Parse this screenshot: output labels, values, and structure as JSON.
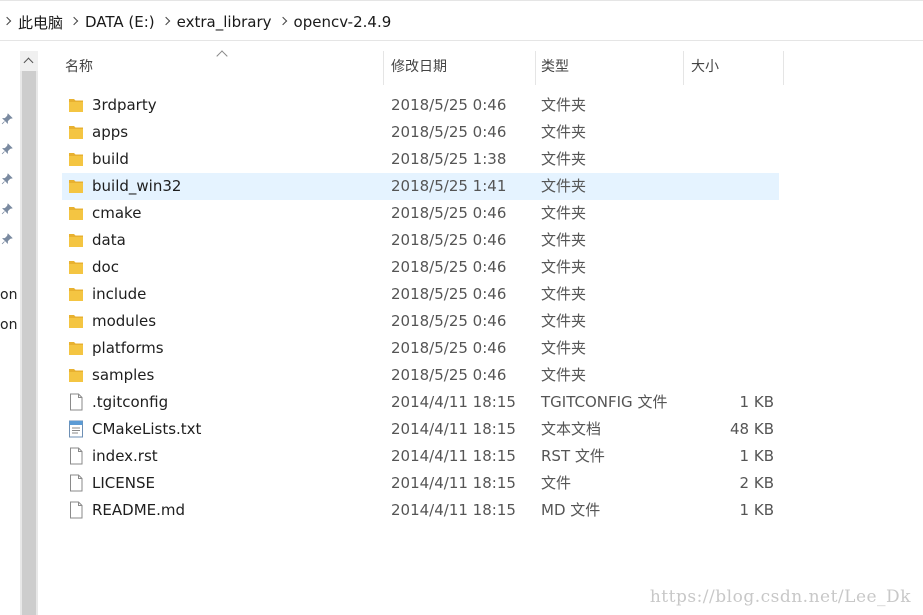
{
  "breadcrumbs": [
    "此电脑",
    "DATA (E:)",
    "extra_library",
    "opencv-2.4.9"
  ],
  "nav_pane_text": [
    "on",
    "on"
  ],
  "columns": {
    "name": "名称",
    "date": "修改日期",
    "type": "类型",
    "size": "大小"
  },
  "files": [
    {
      "name": "3rdparty",
      "date": "2018/5/25 0:46",
      "type": "文件夹",
      "size": "",
      "icon": "folder"
    },
    {
      "name": "apps",
      "date": "2018/5/25 0:46",
      "type": "文件夹",
      "size": "",
      "icon": "folder"
    },
    {
      "name": "build",
      "date": "2018/5/25 1:38",
      "type": "文件夹",
      "size": "",
      "icon": "folder"
    },
    {
      "name": "build_win32",
      "date": "2018/5/25 1:41",
      "type": "文件夹",
      "size": "",
      "icon": "folder",
      "selected": true
    },
    {
      "name": "cmake",
      "date": "2018/5/25 0:46",
      "type": "文件夹",
      "size": "",
      "icon": "folder"
    },
    {
      "name": "data",
      "date": "2018/5/25 0:46",
      "type": "文件夹",
      "size": "",
      "icon": "folder"
    },
    {
      "name": "doc",
      "date": "2018/5/25 0:46",
      "type": "文件夹",
      "size": "",
      "icon": "folder"
    },
    {
      "name": "include",
      "date": "2018/5/25 0:46",
      "type": "文件夹",
      "size": "",
      "icon": "folder"
    },
    {
      "name": "modules",
      "date": "2018/5/25 0:46",
      "type": "文件夹",
      "size": "",
      "icon": "folder"
    },
    {
      "name": "platforms",
      "date": "2018/5/25 0:46",
      "type": "文件夹",
      "size": "",
      "icon": "folder"
    },
    {
      "name": "samples",
      "date": "2018/5/25 0:46",
      "type": "文件夹",
      "size": "",
      "icon": "folder"
    },
    {
      "name": ".tgitconfig",
      "date": "2014/4/11 18:15",
      "type": "TGITCONFIG 文件",
      "size": "1 KB",
      "icon": "file"
    },
    {
      "name": "CMakeLists.txt",
      "date": "2014/4/11 18:15",
      "type": "文本文档",
      "size": "48 KB",
      "icon": "text-document"
    },
    {
      "name": "index.rst",
      "date": "2014/4/11 18:15",
      "type": "RST 文件",
      "size": "1 KB",
      "icon": "file"
    },
    {
      "name": "LICENSE",
      "date": "2014/4/11 18:15",
      "type": "文件",
      "size": "2 KB",
      "icon": "file"
    },
    {
      "name": "README.md",
      "date": "2014/4/11 18:15",
      "type": "MD 文件",
      "size": "1 KB",
      "icon": "file"
    }
  ],
  "watermark": "https://blog.csdn.net/Lee_Dk",
  "colors": {
    "folder": "#f4c542",
    "selected_row": "#e5f3ff",
    "scrollbar_thumb": "#cdcdcd"
  }
}
